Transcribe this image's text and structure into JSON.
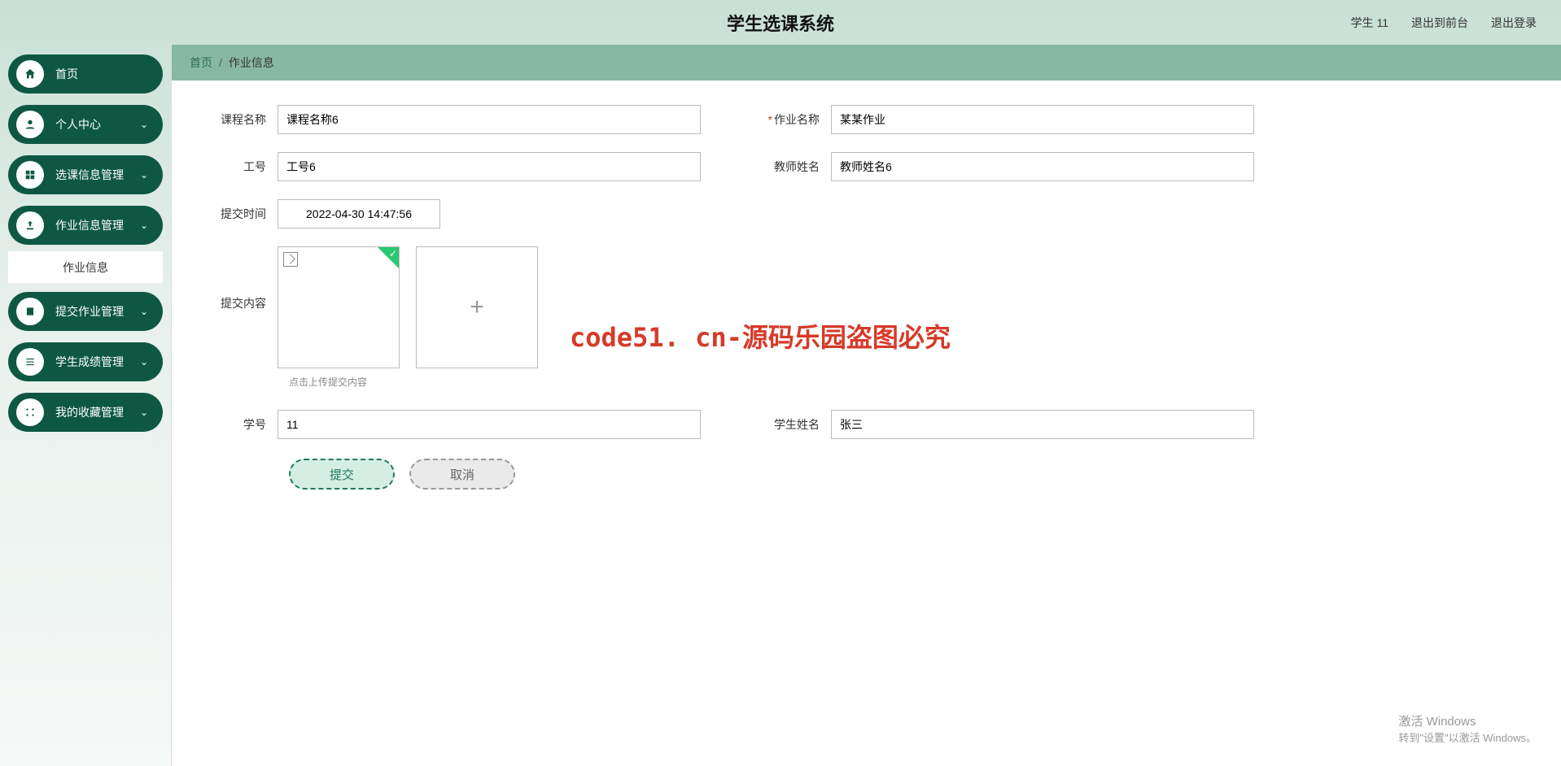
{
  "header": {
    "title": "学生选课系统",
    "user_label": "学生 11",
    "front_link": "退出到前台",
    "logout_link": "退出登录"
  },
  "sidebar": {
    "items": [
      {
        "label": "首页",
        "icon": "home",
        "expandable": false
      },
      {
        "label": "个人中心",
        "icon": "user",
        "expandable": true
      },
      {
        "label": "选课信息管理",
        "icon": "grid",
        "expandable": true
      },
      {
        "label": "作业信息管理",
        "icon": "upload",
        "expandable": true,
        "active": true
      },
      {
        "label": "提交作业管理",
        "icon": "book",
        "expandable": true
      },
      {
        "label": "学生成绩管理",
        "icon": "list",
        "expandable": true
      },
      {
        "label": "我的收藏管理",
        "icon": "star",
        "expandable": true
      }
    ],
    "active_sub": "作业信息"
  },
  "breadcrumb": {
    "root": "首页",
    "current": "作业信息"
  },
  "form": {
    "course_name": {
      "label": "课程名称",
      "value": "课程名称6"
    },
    "task_name": {
      "label": "作业名称",
      "value": "某某作业",
      "required": true
    },
    "staff_no": {
      "label": "工号",
      "value": "工号6"
    },
    "teacher_name": {
      "label": "教师姓名",
      "value": "教师姓名6"
    },
    "submit_time": {
      "label": "提交时间",
      "value": "2022-04-30 14:47:56"
    },
    "submit_content": {
      "label": "提交内容",
      "hint": "点击上传提交内容"
    },
    "student_no": {
      "label": "学号",
      "value": "11"
    },
    "student_name": {
      "label": "学生姓名",
      "value": "张三"
    }
  },
  "buttons": {
    "submit": "提交",
    "cancel": "取消"
  },
  "watermark": "code51. cn-源码乐园盗图必究",
  "activate": {
    "title": "激活 Windows",
    "sub": "转到\"设置\"以激活 Windows。"
  }
}
